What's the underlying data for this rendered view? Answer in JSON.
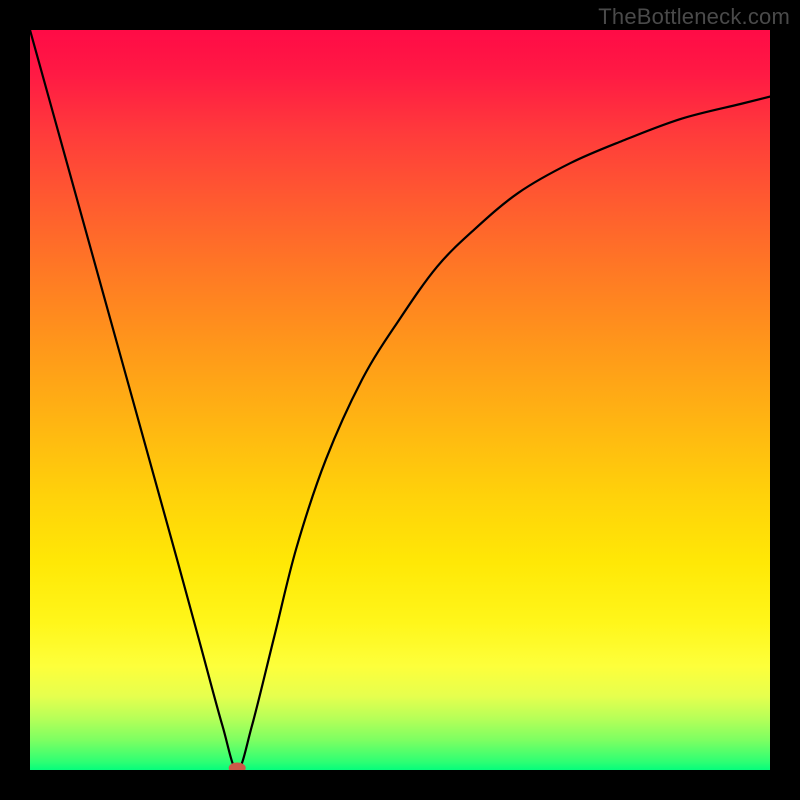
{
  "watermark": "TheBottleneck.com",
  "chart_data": {
    "type": "line",
    "title": "",
    "xlabel": "",
    "ylabel": "",
    "xlim": [
      0,
      100
    ],
    "ylim": [
      0,
      100
    ],
    "grid": false,
    "legend": false,
    "background": "red-yellow-green vertical gradient (top=red=high bottleneck, bottom=green=low bottleneck)",
    "series": [
      {
        "name": "bottleneck-curve",
        "x": [
          0,
          5,
          10,
          15,
          20,
          23,
          26,
          28,
          30,
          33,
          36,
          40,
          45,
          50,
          55,
          60,
          66,
          73,
          80,
          88,
          96,
          100
        ],
        "values": [
          100,
          82,
          64,
          46,
          28,
          17,
          6,
          0,
          6,
          18,
          30,
          42,
          53,
          61,
          68,
          73,
          78,
          82,
          85,
          88,
          90,
          91
        ]
      }
    ],
    "annotations": [
      {
        "name": "optimal-point",
        "x": 28,
        "y": 0,
        "shape": "ellipse",
        "color": "#cc5a49"
      }
    ]
  }
}
